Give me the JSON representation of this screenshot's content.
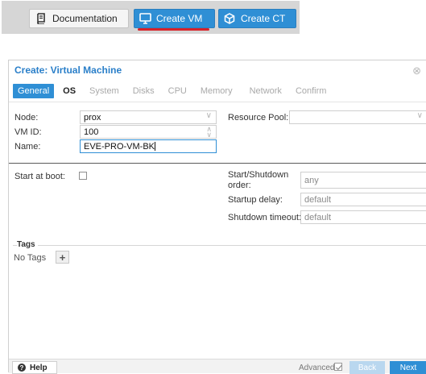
{
  "toolbar": {
    "documentation_label": "Documentation",
    "documentation_icon": "book-icon",
    "create_vm_label": "Create VM",
    "create_vm_icon": "monitor-icon",
    "create_ct_label": "Create CT",
    "create_ct_icon": "cube-icon",
    "accent_color": "#2f8fd5",
    "underline_color": "#d8232a"
  },
  "dialog": {
    "title": "Create: Virtual Machine",
    "close_icon": "close-circle-icon",
    "tabs": [
      {
        "label": "General",
        "state": "active"
      },
      {
        "label": "OS",
        "state": "enabled"
      },
      {
        "label": "System",
        "state": "disabled"
      },
      {
        "label": "Disks",
        "state": "disabled"
      },
      {
        "label": "CPU",
        "state": "disabled"
      },
      {
        "label": "Memory",
        "state": "disabled"
      },
      {
        "label": "Network",
        "state": "disabled"
      },
      {
        "label": "Confirm",
        "state": "disabled"
      }
    ],
    "general": {
      "node_label": "Node:",
      "node_value": "prox",
      "vmid_label": "VM ID:",
      "vmid_value": "100",
      "name_label": "Name:",
      "name_value": "EVE-PRO-VM-BK",
      "resource_pool_label": "Resource Pool:",
      "resource_pool_value": "",
      "start_at_boot_label": "Start at boot:",
      "start_at_boot_checked": false,
      "start_shutdown_order_label": "Start/Shutdown order:",
      "start_shutdown_order_value": "any",
      "startup_delay_label": "Startup delay:",
      "startup_delay_value": "default",
      "shutdown_timeout_label": "Shutdown timeout:",
      "shutdown_timeout_value": "default"
    },
    "tags": {
      "legend": "Tags",
      "empty_text": "No Tags",
      "add_icon": "plus-icon"
    },
    "footer": {
      "help_label": "Help",
      "help_icon": "question-circle-icon",
      "advanced_label": "Advanced",
      "advanced_checked": true,
      "back_label": "Back",
      "next_label": "Next"
    }
  }
}
